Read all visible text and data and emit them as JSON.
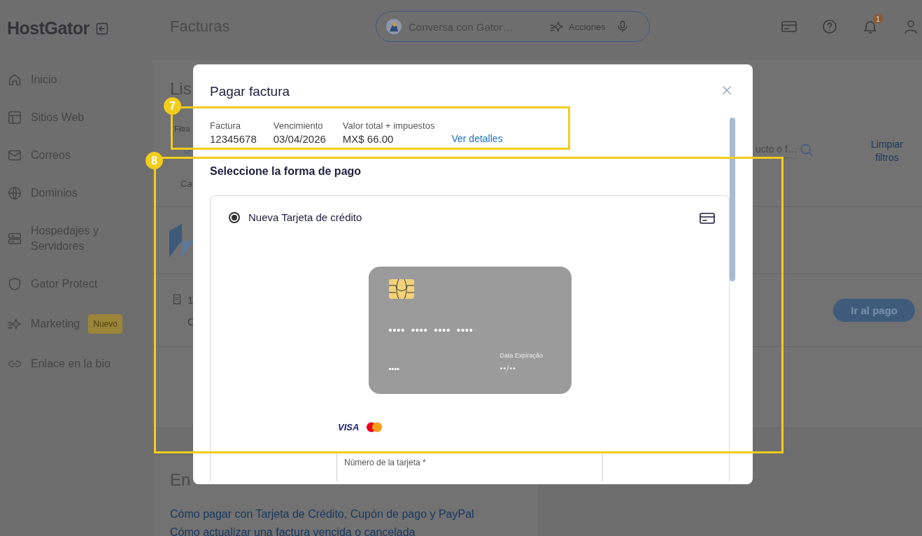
{
  "sidebar": {
    "logo": "HostGator",
    "items": [
      {
        "label": "Inicio"
      },
      {
        "label": "Sitios Web"
      },
      {
        "label": "Correos"
      },
      {
        "label": "Dominios"
      },
      {
        "label": "Hospedajes y Servidores"
      },
      {
        "label": "Gator Protect"
      },
      {
        "label": "Marketing",
        "badge": "Nuevo"
      },
      {
        "label": "Enlace en la bio"
      }
    ]
  },
  "topbar": {
    "title": "Facturas",
    "chat": {
      "placeholder": "Conversa con Gator…",
      "action": "Acciones"
    },
    "notifications": "1"
  },
  "content": {
    "list": {
      "title": "Lis",
      "filter_label": "Filtra",
      "filter_option": "Ca",
      "search": {
        "placeholder": "ucto o f…"
      },
      "clear": "Limpiar filtros"
    },
    "invoice_row": {
      "number": "1",
      "status": "C",
      "pay_button": "Ir al pago"
    },
    "help": {
      "title": "En",
      "links": [
        "Cómo pagar con Tarjeta de Crédito, Cupón de pago y PayPal",
        "Cómo actualizar una factura vencida o cancelada"
      ]
    }
  },
  "modal": {
    "title": "Pagar factura",
    "summary": [
      {
        "label": "Factura",
        "value": "12345678"
      },
      {
        "label": "Vencimiento",
        "value": "03/04/2026"
      },
      {
        "label": "Valor total + impuestos",
        "value": "MX$ 66.00"
      }
    ],
    "details_link": "Ver detalles",
    "heading": "Seleccione la forma de pago",
    "methods": [
      {
        "label": "Nueva Tarjeta de crédito",
        "selected": true
      }
    ],
    "card_preview": {
      "number": "•••• •••• •••• ••••",
      "cvv": "••••",
      "expiry_label": "Data Expiração",
      "expiry": "••/••"
    },
    "brands": [
      {
        "kind": "visa",
        "label": "VISA"
      },
      {
        "kind": "mastercard"
      }
    ],
    "fields": [
      {
        "label": "Número de la tarjeta *"
      }
    ]
  },
  "annotations": [
    {
      "number": "7"
    },
    {
      "number": "8"
    }
  ]
}
